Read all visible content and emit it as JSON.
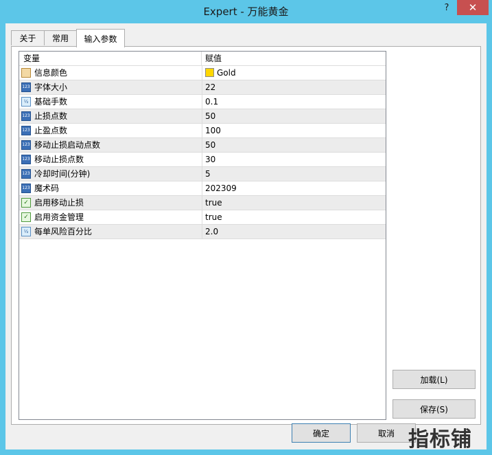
{
  "window": {
    "title": "Expert - 万能黄金",
    "help_glyph": "?",
    "close_glyph": "✕"
  },
  "tabs": [
    {
      "label": "关于"
    },
    {
      "label": "常用"
    },
    {
      "label": "输入参数"
    }
  ],
  "grid": {
    "header": {
      "variable": "变量",
      "value": "赋值"
    },
    "rows": [
      {
        "type": "color",
        "icon": "color-icon",
        "name": "信息颜色",
        "value": "Gold",
        "swatch": "#ffd700"
      },
      {
        "type": "int",
        "icon": "int-icon",
        "name": "字体大小",
        "value": "22"
      },
      {
        "type": "double",
        "icon": "double-icon",
        "name": "基础手数",
        "value": "0.1"
      },
      {
        "type": "int",
        "icon": "int-icon",
        "name": "止损点数",
        "value": "50"
      },
      {
        "type": "int",
        "icon": "int-icon",
        "name": "止盈点数",
        "value": "100"
      },
      {
        "type": "int",
        "icon": "int-icon",
        "name": "移动止损启动点数",
        "value": "50"
      },
      {
        "type": "int",
        "icon": "int-icon",
        "name": "移动止损点数",
        "value": "30"
      },
      {
        "type": "int",
        "icon": "int-icon",
        "name": "冷却时间(分钟)",
        "value": "5"
      },
      {
        "type": "int",
        "icon": "int-icon",
        "name": "魔术码",
        "value": "202309"
      },
      {
        "type": "bool",
        "icon": "bool-icon",
        "name": "启用移动止损",
        "value": "true"
      },
      {
        "type": "bool",
        "icon": "bool-icon",
        "name": "启用资金管理",
        "value": "true"
      },
      {
        "type": "double",
        "icon": "double-icon",
        "name": "每单风险百分比",
        "value": "2.0"
      }
    ]
  },
  "buttons": {
    "load": "加载(L)",
    "save": "保存(S)",
    "ok": "确定",
    "cancel": "取消"
  },
  "watermark": "指标铺",
  "colors": {
    "title_bar": "#5cc6e8",
    "close": "#c75050",
    "gold": "#ffd700"
  }
}
